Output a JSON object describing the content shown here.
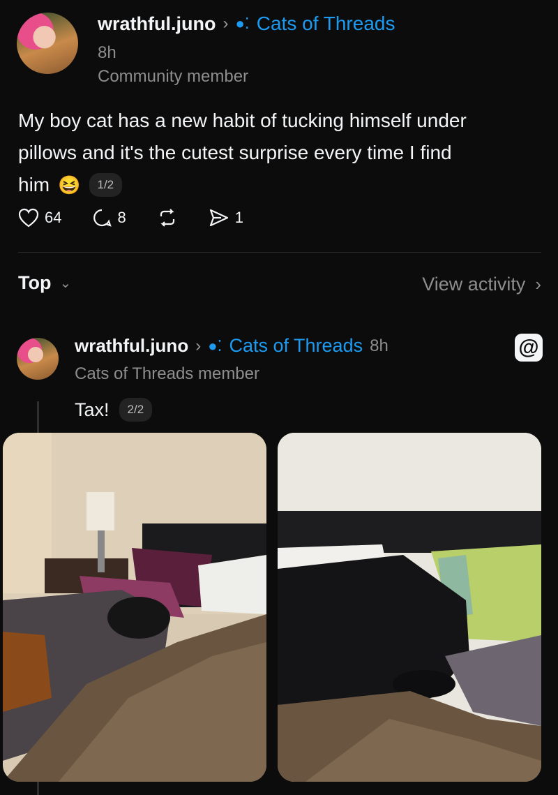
{
  "post1": {
    "username": "wrathful.juno",
    "community": "Cats of Threads",
    "time": "8h",
    "role": "Community member",
    "text_line1": "My boy cat has a new habit of tucking himself under",
    "text_line2": "pillows and it's the cutest surprise every time I find",
    "text_line3": "him",
    "emoji": "😆",
    "page_indicator": "1/2",
    "stats": {
      "likes": "64",
      "comments": "8",
      "shares": "1"
    }
  },
  "sort": {
    "label": "Top",
    "view_activity": "View activity"
  },
  "post2": {
    "username": "wrathful.juno",
    "community": "Cats of Threads",
    "time": "8h",
    "role": "Cats of Threads member",
    "text": "Tax!",
    "page_indicator": "2/2",
    "images": [
      "bedroom-photo-1",
      "bedroom-photo-2"
    ]
  },
  "colors": {
    "background": "#0c0c0d",
    "accent": "#1d9bf0",
    "muted": "#8e8e8e"
  },
  "icons": [
    "heart-icon",
    "comment-icon",
    "repost-icon",
    "share-icon",
    "threads-logo-icon",
    "chevron-right-icon",
    "chevron-down-icon",
    "community-dots-icon"
  ]
}
